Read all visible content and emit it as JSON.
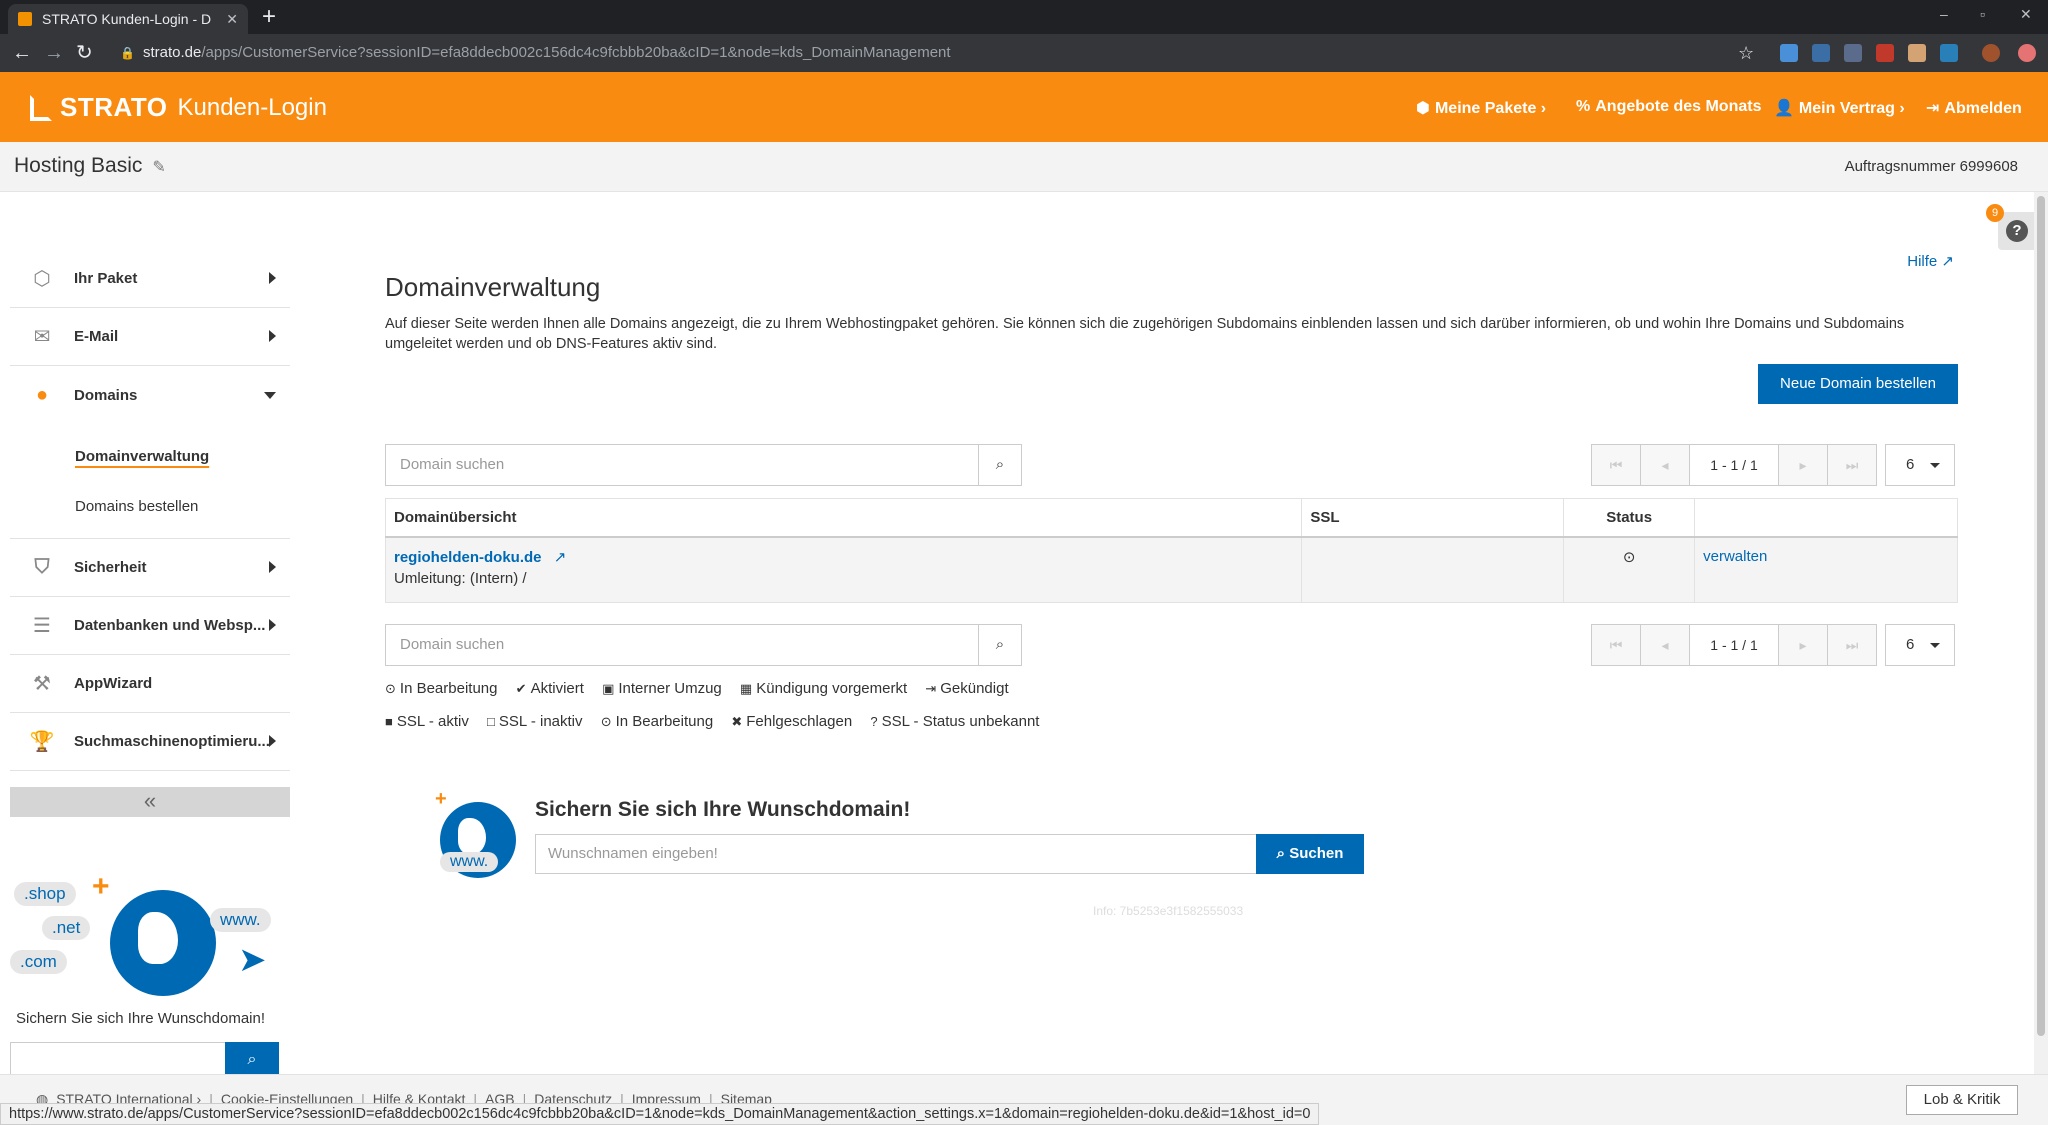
{
  "browser": {
    "tab_title": "STRATO Kunden-Login - D",
    "url_host": "strato.de",
    "url_path": "/apps/CustomerService?sessionID=efa8ddecb002c156dc4c9fcbbb20ba&cID=1&node=kds_DomainManagement",
    "status_url": "https://www.strato.de/apps/CustomerService?sessionID=efa8ddecb002c156dc4c9fcbbb20ba&cID=1&node=kds_DomainManagement&action_settings.x=1&domain=regiohelden-doku.de&id=1&host_id=0"
  },
  "header": {
    "brand": "STRATO",
    "subtitle": "Kunden-Login",
    "nav": [
      "Meine Pakete ›",
      "Angebote des Monats",
      "Mein Vertrag ›",
      "Abmelden"
    ]
  },
  "subheader": {
    "package": "Hosting Basic",
    "order_number": "Auftragsnummer 6999608"
  },
  "sidebar": {
    "items": [
      {
        "label": "Ihr Paket"
      },
      {
        "label": "E-Mail"
      },
      {
        "label": "Domains"
      },
      {
        "label": "Sicherheit"
      },
      {
        "label": "Datenbanken und Websp..."
      },
      {
        "label": "AppWizard"
      },
      {
        "label": "Suchmaschinenoptimieru..."
      }
    ],
    "domains_sub": [
      "Domainverwaltung",
      "Domains bestellen"
    ],
    "collapse": "«",
    "promo": {
      "bubbles": [
        ".shop",
        ".net",
        ".com",
        "www."
      ],
      "title": "Sichern Sie sich Ihre Wunschdomain!"
    }
  },
  "main": {
    "help": "Hilfe",
    "title": "Domainverwaltung",
    "description": "Auf dieser Seite werden Ihnen alle Domains angezeigt, die zu Ihrem Webhostingpaket gehören. Sie können sich die zugehörigen Subdomains einblenden lassen und sich darüber informieren, ob und wohin Ihre Domains und Subdomains umgeleitet werden und ob DNS-Features aktiv sind.",
    "new_domain_button": "Neue Domain bestellen",
    "search_placeholder": "Domain suchen",
    "pager_range": "1 - 1 / 1",
    "page_size": "6",
    "table": {
      "headers": [
        "Domainübersicht",
        "SSL",
        "Status",
        ""
      ],
      "rows": [
        {
          "domain": "regiohelden-doku.de",
          "redirect": "Umleitung: (Intern) /",
          "action": "verwalten"
        }
      ]
    },
    "legend_status": [
      "In Bearbeitung",
      "Aktiviert",
      "Interner Umzug",
      "Kündigung vorgemerkt",
      "Gekündigt"
    ],
    "legend_ssl": [
      "SSL - aktiv",
      "SSL - inaktiv",
      "In Bearbeitung",
      "Fehlgeschlagen",
      "SSL - Status unbekannt"
    ],
    "wish": {
      "title": "Sichern Sie sich Ihre Wunschdomain!",
      "placeholder": "Wunschnamen eingeben!",
      "button": "Suchen",
      "www": "www."
    },
    "info": "Info: 7b5253e3f1582555033"
  },
  "helper_badge": "9",
  "footer": {
    "links": [
      "STRATO International ›",
      "Cookie-Einstellungen",
      "Hilfe & Kontakt",
      "AGB",
      "Datenschutz",
      "Impressum",
      "Sitemap"
    ],
    "feedback": "Lob & Kritik"
  }
}
